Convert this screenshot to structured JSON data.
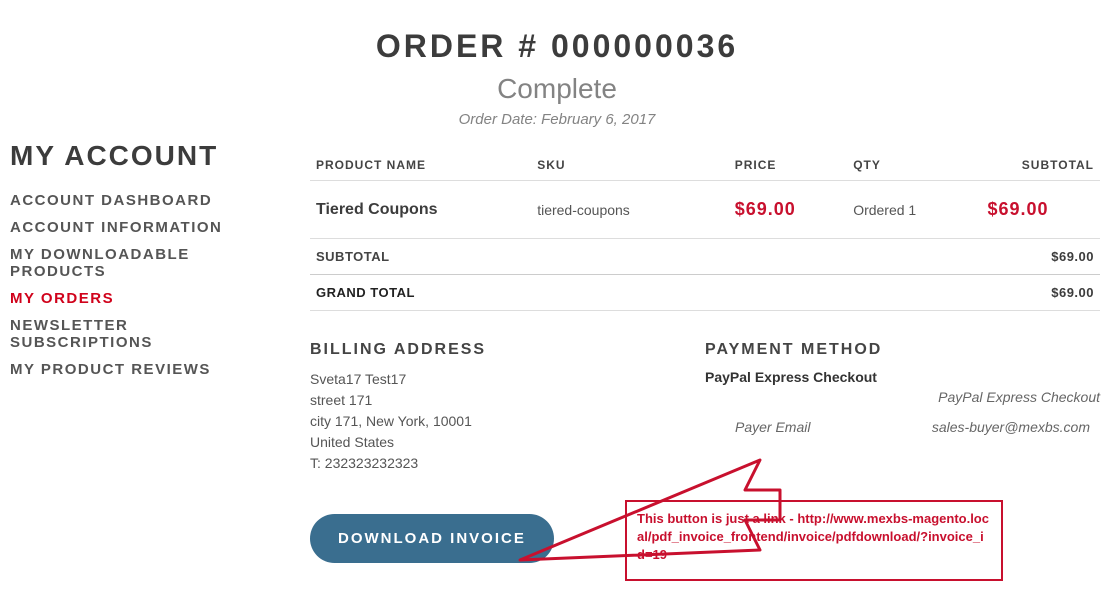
{
  "header": {
    "title": "ORDER # 000000036",
    "status": "Complete",
    "date_label": "Order Date: February 6, 2017"
  },
  "sidebar": {
    "title": "MY ACCOUNT",
    "items": [
      {
        "label": "ACCOUNT DASHBOARD",
        "active": false
      },
      {
        "label": "ACCOUNT INFORMATION",
        "active": false
      },
      {
        "label": "MY DOWNLOADABLE PRODUCTS",
        "active": false
      },
      {
        "label": "MY ORDERS",
        "active": true
      },
      {
        "label": "NEWSLETTER SUBSCRIPTIONS",
        "active": false
      },
      {
        "label": "MY PRODUCT REVIEWS",
        "active": false
      }
    ]
  },
  "table": {
    "headers": {
      "product": "PRODUCT NAME",
      "sku": "SKU",
      "price": "PRICE",
      "qty": "QTY",
      "subtotal": "SUBTOTAL"
    },
    "rows": [
      {
        "product": "Tiered Coupons",
        "sku": "tiered-coupons",
        "price": "$69.00",
        "qty": "Ordered 1",
        "subtotal": "$69.00"
      }
    ],
    "subtotal_label": "SUBTOTAL",
    "subtotal_value": "$69.00",
    "grand_label": "GRAND TOTAL",
    "grand_value": "$69.00"
  },
  "billing": {
    "title": "BILLING ADDRESS",
    "lines": [
      "Sveta17 Test17",
      "street 171",
      "city 171, New York, 10001",
      "United States",
      "T: 232323232323"
    ]
  },
  "payment": {
    "title": "PAYMENT METHOD",
    "method": "PayPal Express Checkout",
    "subtitle": "PayPal Express Checkout",
    "payer_label": "Payer Email",
    "payer_email": "sales-buyer@mexbs.com"
  },
  "download_button": "DOWNLOAD INVOICE",
  "annotation": {
    "text": "This button is just a link - http://www.mexbs-magento.local/pdf_invoice_frontend/invoice/pdfdownload/?invoice_id=19"
  }
}
